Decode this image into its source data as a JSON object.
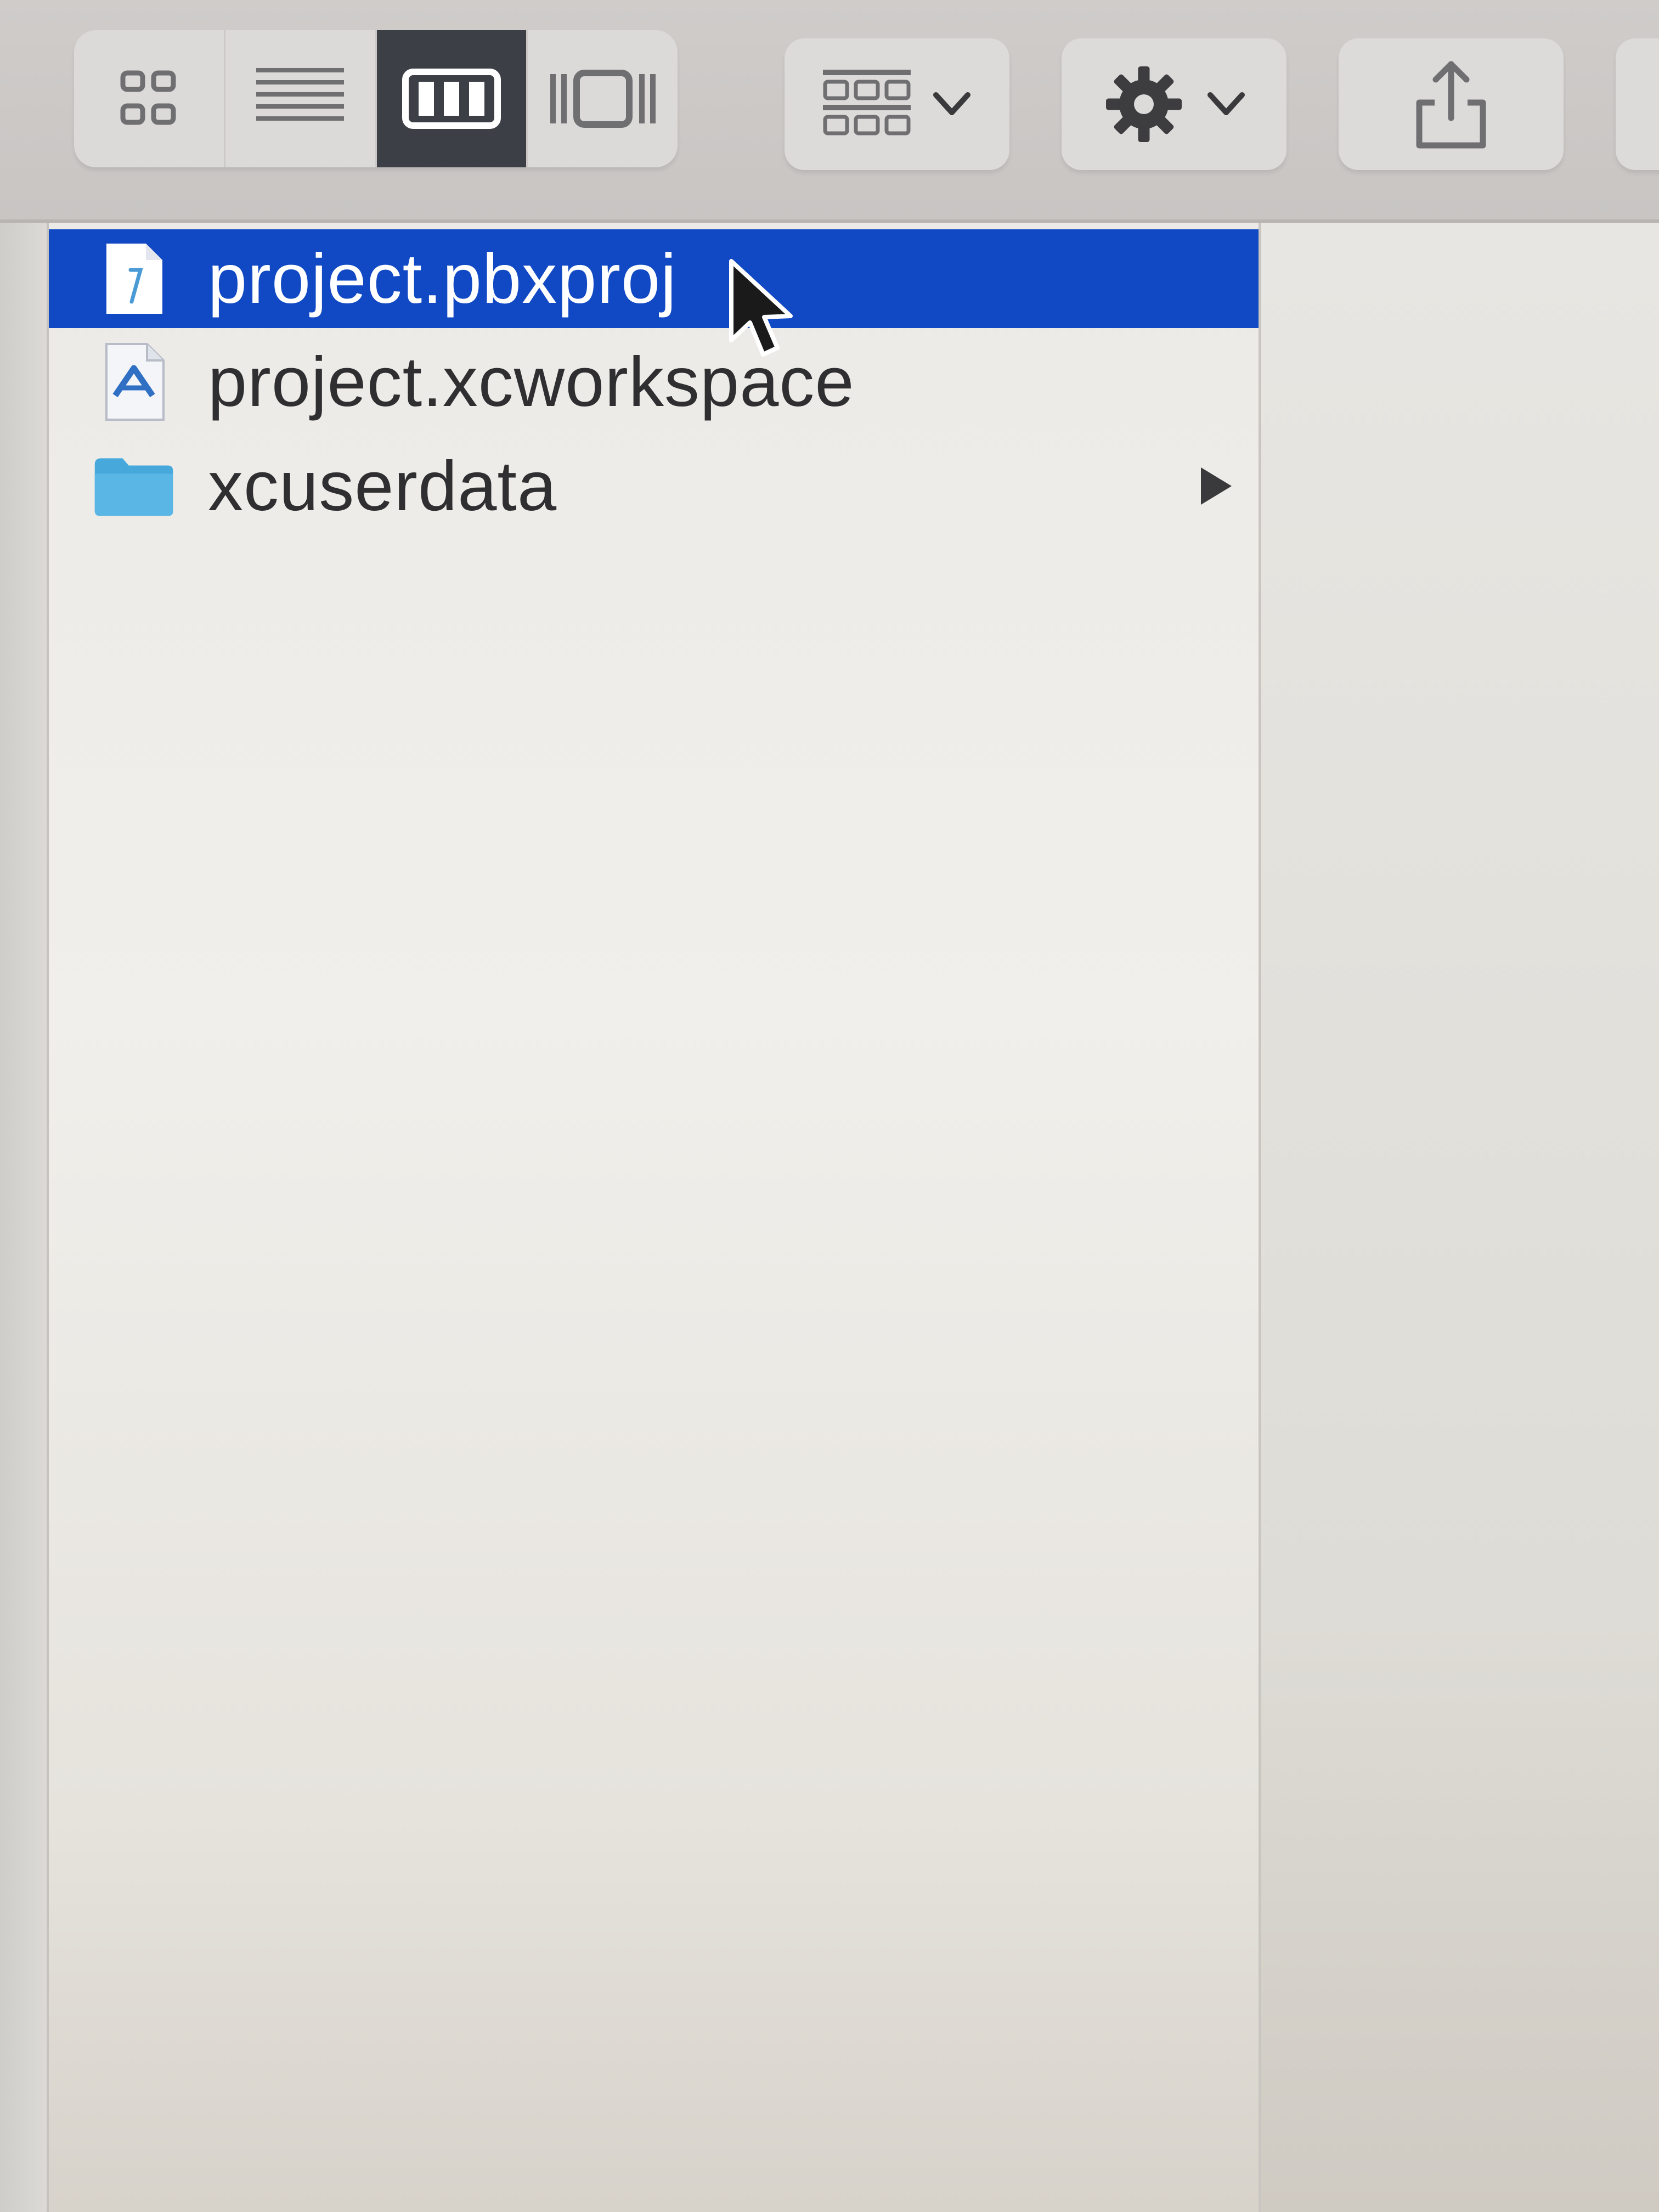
{
  "toolbar": {
    "view_modes": [
      {
        "name": "icon-view",
        "icon": "icon-view-icon",
        "active": false
      },
      {
        "name": "list-view",
        "icon": "list-view-icon",
        "active": false
      },
      {
        "name": "column-view",
        "icon": "column-view-icon",
        "active": true
      },
      {
        "name": "gallery-view",
        "icon": "gallery-view-icon",
        "active": false
      }
    ],
    "group_button_icon": "group-icon",
    "action_button_icon": "gear-icon",
    "share_button_icon": "share-icon"
  },
  "column": {
    "items": [
      {
        "label": "project.pbxproj",
        "icon": "document-icon",
        "selected": true,
        "has_children": false
      },
      {
        "label": "project.xcworkspace",
        "icon": "xcode-workspace-icon",
        "selected": false,
        "has_children": false
      },
      {
        "label": "xcuserdata",
        "icon": "folder-icon",
        "selected": false,
        "has_children": true
      }
    ]
  },
  "colors": {
    "selection": "#1149c4",
    "folder": "#47a8dc",
    "active_segment": "#3d3f46"
  }
}
